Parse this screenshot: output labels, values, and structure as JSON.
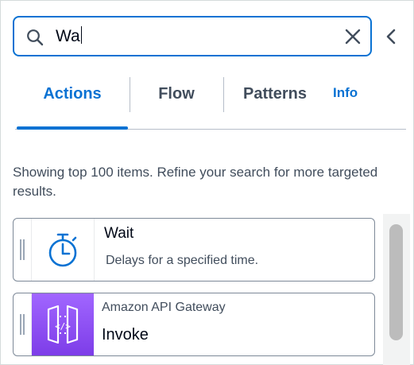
{
  "search": {
    "value": "Wa",
    "icon": "search-icon",
    "clear_icon": "close-icon",
    "collapse_icon": "chevron-left-icon"
  },
  "tabs": {
    "items": [
      {
        "label": "Actions",
        "active": true
      },
      {
        "label": "Flow",
        "active": false
      },
      {
        "label": "Patterns",
        "active": false
      }
    ],
    "info_label": "Info"
  },
  "results": {
    "note": "Showing top 100 items. Refine your search for more targeted results.",
    "items": [
      {
        "title": "Wait",
        "description": "Delays for a specified time.",
        "icon": "timer-icon"
      },
      {
        "service": "Amazon API Gateway",
        "name": "Invoke",
        "icon": "api-gateway-icon"
      }
    ]
  },
  "colors": {
    "accent": "#0972d3",
    "text": "#000716",
    "secondary_text": "#414d5c",
    "api_gateway_purple": "#8c4fff"
  }
}
